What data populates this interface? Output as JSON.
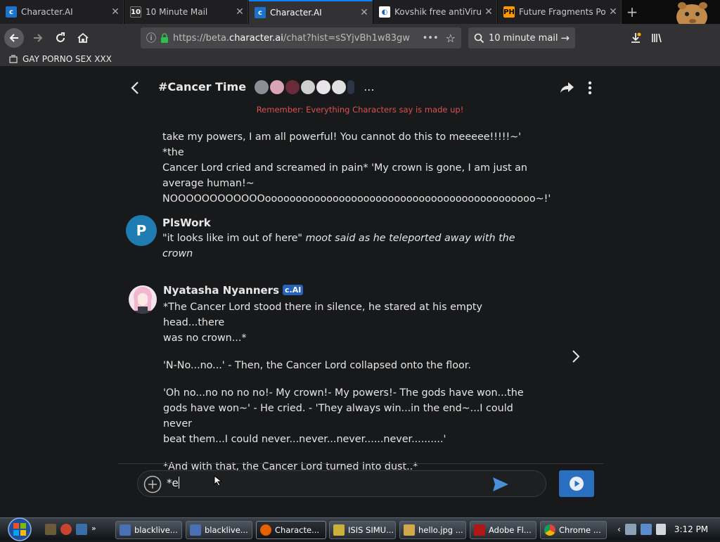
{
  "browser": {
    "tabs": [
      {
        "label": "Character.AI",
        "favicon": "cai-icon",
        "active": false
      },
      {
        "label": "10 Minute Mail",
        "favicon": "10-icon",
        "active": false
      },
      {
        "label": "Character.AI",
        "favicon": "cai-icon",
        "active": true
      },
      {
        "label": "Kovshik free antiVirus",
        "favicon": "kovshik-icon",
        "active": false
      },
      {
        "label": "Future Fragments Po",
        "favicon": "ph-icon",
        "active": false
      }
    ],
    "url_prefix": "https://beta.",
    "url_domain": "character.ai",
    "url_suffix": "/chat?hist=sSYjvBh1w83gw",
    "search_value": "10 minute mail",
    "bookmark": "GAY PORNO SEX XXX"
  },
  "chat": {
    "title": "#Cancer Time",
    "title_more": "...",
    "disclaimer": "Remember: Everything Characters say is made up!",
    "message1": {
      "lines": [
        "take my powers, I am all powerful! You cannot do this to meeeee!!!!!~' *the",
        "Cancer Lord cried and screamed in pain* 'My crown is gone, I am just an",
        "average human!~",
        "NOOOOOOOOOOOOoooooooooooooooooooooooooooooooooooooooooooo~!'"
      ]
    },
    "message2": {
      "author": "PlsWork",
      "avatar_letter": "P",
      "text_plain": "\"it looks like im out of here\" ",
      "text_italic": "moot said as he teleported away with the crown"
    },
    "message3": {
      "author": "Nyatasha Nyanners",
      "badge": "c.AI",
      "p1_line1": "*The Cancer Lord stood there in silence, he stared at his empty head...there",
      "p1_line2": "was no crown...*",
      "p2": "'N-No...no...' - Then, the Cancer Lord collapsed onto the floor.",
      "p3_line1": "'Oh no...no no no no!- My crown!- My powers!- The gods have won...the",
      "p3_line2": "gods have won~' - He cried. - 'They always win...in the end~...I could never",
      "p3_line3": "beat them...I could never...never...never......never..........'",
      "p4": "*And with that, the Cancer Lord turned into dust..*"
    },
    "input_value": "*e"
  },
  "taskbar": {
    "items": [
      {
        "label": "blacklive...",
        "icon": "document-icon"
      },
      {
        "label": "blacklive...",
        "icon": "document-icon"
      },
      {
        "label": "Characte...",
        "icon": "firefox-icon"
      },
      {
        "label": "ISIS SIMU...",
        "icon": "app-icon"
      },
      {
        "label": "hello.jpg ...",
        "icon": "image-icon"
      },
      {
        "label": "Adobe Fl...",
        "icon": "flash-icon"
      },
      {
        "label": "Chrome ...",
        "icon": "chrome-icon"
      }
    ],
    "clock": "3:12 PM"
  },
  "colors": {
    "accent": "#2a6fbf",
    "disclaimer": "#d9534f",
    "badge": "#2662b8",
    "avatar_p": "#1f7cb3"
  }
}
